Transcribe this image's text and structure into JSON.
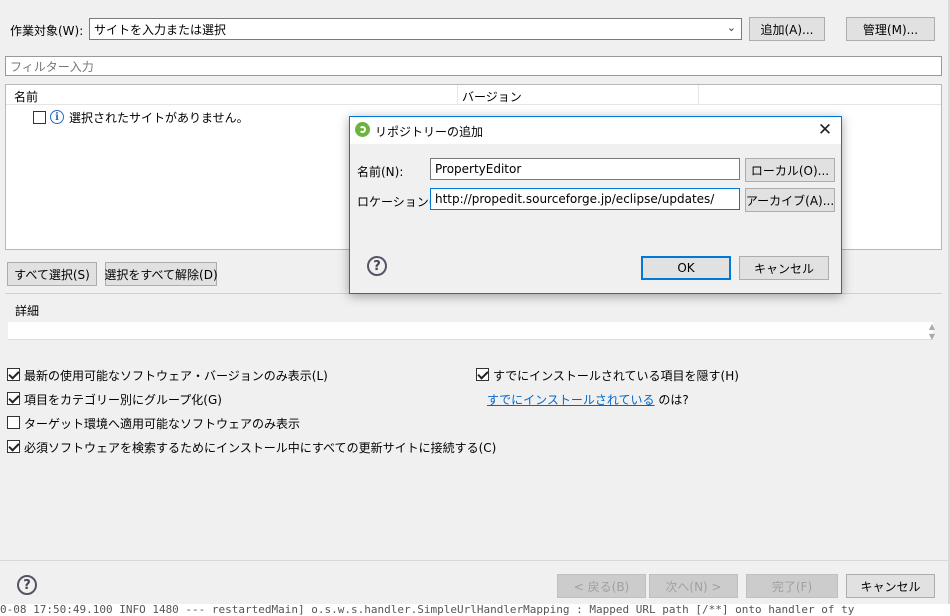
{
  "header": {
    "work_target_label": "作業対象(W):",
    "site_select_value": "サイトを入力または選択",
    "add_button": "追加(A)...",
    "manage_button": "管理(M)..."
  },
  "filter": {
    "placeholder": "フィルター入力"
  },
  "table": {
    "columns": [
      "名前",
      "バージョン"
    ],
    "empty_message": "選択されたサイトがありません。"
  },
  "selection": {
    "select_all": "すべて選択(S)",
    "deselect_all": "選択をすべて解除(D)"
  },
  "details": {
    "label": "詳細"
  },
  "options": {
    "latest_only": "最新の使用可能なソフトウェア・バージョンのみ表示(L)",
    "group_by_category": "項目をカテゴリー別にグループ化(G)",
    "target_env_only": "ターゲット環境へ適用可能なソフトウェアのみ表示",
    "contact_all_sites": "必須ソフトウェアを検索するためにインストール中にすべての更新サイトに接続する(C)",
    "hide_installed": "すでにインストールされている項目を隠す(H)",
    "already_installed_link": "すでにインストールされている",
    "already_installed_suffix": " のは?"
  },
  "footer": {
    "back": "< 戻る(B)",
    "next": "次へ(N) >",
    "finish": "完了(F)",
    "cancel": "キャンセル"
  },
  "dialog": {
    "title": "リポジトリーの追加",
    "name_label": "名前(N):",
    "name_value": "PropertyEditor",
    "local_button": "ローカル(O)...",
    "location_label": "ロケーション(L):",
    "location_value": "http://propedit.sourceforge.jp/eclipse/updates/",
    "archive_button": "アーカイブ(A)...",
    "ok": "OK",
    "cancel": "キャンセル"
  },
  "console": {
    "log_line": "0-08 17:50:49.100  INFO 1480   ---  restartedMain] o.s.w.s.handler.SimpleUrlHandlerMapping  : Mapped URL path [/**] onto handler of ty"
  },
  "colors": {
    "accent": "#0078d7",
    "link": "#0066cc",
    "background": "#f0f0f0"
  }
}
